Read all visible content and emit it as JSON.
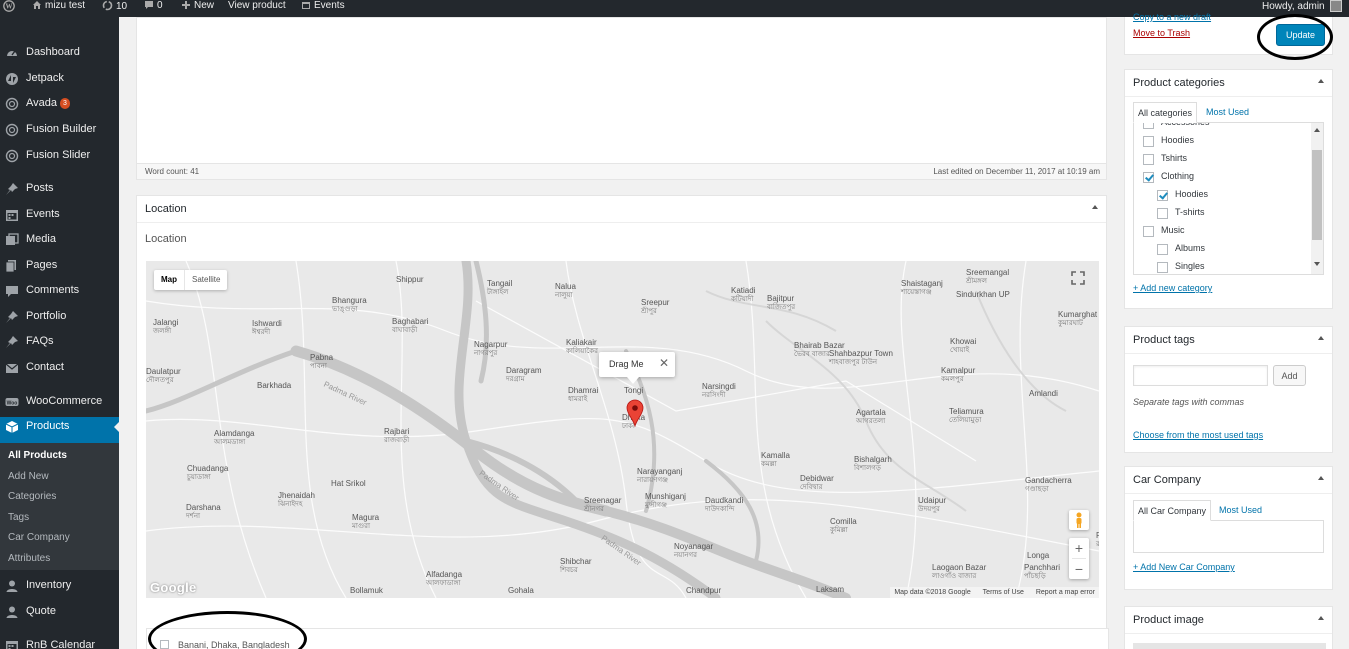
{
  "admin_bar": {
    "site_name": "mizu test",
    "updates_count": "10",
    "comments_count": "0",
    "new_label": "New",
    "view_product": "View product",
    "events": "Events",
    "howdy": "Howdy, admin"
  },
  "menu": [
    {
      "label": "Dashboard",
      "icon": "dashboard-icon"
    },
    {
      "label": "Jetpack",
      "icon": "jetpack-icon"
    },
    {
      "label": "Avada",
      "icon": "avada-icon",
      "badge": "3"
    },
    {
      "label": "Fusion Builder",
      "icon": "fusion-builder-icon"
    },
    {
      "label": "Fusion Slider",
      "icon": "fusion-slider-icon"
    },
    {
      "label": "Posts",
      "icon": "pin-icon"
    },
    {
      "label": "Events",
      "icon": "calendar-icon"
    },
    {
      "label": "Media",
      "icon": "media-icon"
    },
    {
      "label": "Pages",
      "icon": "pages-icon"
    },
    {
      "label": "Comments",
      "icon": "comments-icon"
    },
    {
      "label": "Portfolio",
      "icon": "pin-icon"
    },
    {
      "label": "FAQs",
      "icon": "pin-icon"
    },
    {
      "label": "Contact",
      "icon": "mail-icon"
    },
    {
      "label": "WooCommerce",
      "icon": "woo-icon"
    },
    {
      "label": "Products",
      "icon": "products-icon"
    },
    {
      "label": "Inventory",
      "icon": "users-icon"
    },
    {
      "label": "Quote",
      "icon": "users-icon"
    },
    {
      "label": "RnB Calendar",
      "icon": "calendar-icon"
    }
  ],
  "submenu": [
    "All Products",
    "Add New",
    "Categories",
    "Tags",
    "Car Company",
    "Attributes"
  ],
  "editor": {
    "word_count": "Word count: 41",
    "last_edited": "Last edited on December 11, 2017 at 10:19 am"
  },
  "location": {
    "box_title": "Location",
    "field_label": "Location",
    "map_tab": "Map",
    "satellite_tab": "Satellite",
    "marker_label": "Drag Me",
    "address": "Banani, Dhaka, Bangladesh",
    "map_footer": [
      "Map data ©2018 Google",
      "Terms of Use",
      "Report a map error"
    ],
    "google_logo": "Google",
    "zoom_in": "+",
    "zoom_out": "−"
  },
  "towns": [
    {
      "en": "Shippur",
      "bn": ""
    },
    {
      "en": "Tangail",
      "bn": "টাঙ্গাইল"
    },
    {
      "en": "Nalua",
      "bn": "নালুয়া"
    },
    {
      "en": "Sreepur",
      "bn": "শ্রীপুর"
    },
    {
      "en": "Katiadi",
      "bn": "কটিয়াদী"
    },
    {
      "en": "Bajitpur",
      "bn": "বাজিতপুর"
    },
    {
      "en": "Shaistaganj",
      "bn": "শায়েস্তাগঞ্জ"
    },
    {
      "en": "Sreemangal",
      "bn": "শ্রীমঙ্গল"
    },
    {
      "en": "Sindurkhan UP",
      "bn": ""
    },
    {
      "en": "Bhangura",
      "bn": "ভাঙ্গুড়া"
    },
    {
      "en": "Baghabari",
      "bn": "বাঘাবাড়ী"
    },
    {
      "en": "Ishwardi",
      "bn": "ঈশ্বরদী"
    },
    {
      "en": "Jalangi",
      "bn": "জলঙ্গী"
    },
    {
      "en": "Nagarpur",
      "bn": "নাগরপুর"
    },
    {
      "en": "Kaliakair",
      "bn": "কালিয়াকৈর"
    },
    {
      "en": "Bhairab Bazar",
      "bn": "ভৈরব বাজার"
    },
    {
      "en": "Shahbazpur Town",
      "bn": "শাহবাজপুর টাউন"
    },
    {
      "en": "Khowai",
      "bn": "খোয়াই"
    },
    {
      "en": "Kumarghat",
      "bn": "কুমারঘাট"
    },
    {
      "en": "Pabna",
      "bn": "পাবনা"
    },
    {
      "en": "Daulatpur",
      "bn": "দৌলতপুর"
    },
    {
      "en": "Daragram",
      "bn": "দরগ্রাম"
    },
    {
      "en": "Tongi",
      "bn": ""
    },
    {
      "en": "Dhamrai",
      "bn": "ধামরাই"
    },
    {
      "en": "Narsingdi",
      "bn": "নরসিংদী"
    },
    {
      "en": "Kamalpur",
      "bn": "কমলপুর"
    },
    {
      "en": "Barkhada",
      "bn": ""
    },
    {
      "en": "Dhaka",
      "bn": "ঢাকা"
    },
    {
      "en": "Agartala",
      "bn": "আগরতলা"
    },
    {
      "en": "Teliamura",
      "bn": "তেলিয়ামুড়া"
    },
    {
      "en": "Amlandi",
      "bn": ""
    },
    {
      "en": "Alamdanga",
      "bn": "আলমডাঙ্গা"
    },
    {
      "en": "Rajbari",
      "bn": "রাজবাড়ী"
    },
    {
      "en": "Kamalla",
      "bn": "কমল্লা"
    },
    {
      "en": "Bishalgarh",
      "bn": "বিশালগড়"
    },
    {
      "en": "Chuadanga",
      "bn": "চুয়াডাঙ্গা"
    },
    {
      "en": "Narayanganj",
      "bn": "নারায়ণগঞ্জ"
    },
    {
      "en": "Hat Srikol",
      "bn": ""
    },
    {
      "en": "Jhenaidah",
      "bn": "ঝিনাইদহ"
    },
    {
      "en": "Munshiganj",
      "bn": "মুন্সীগঞ্জ"
    },
    {
      "en": "Debidwar",
      "bn": "দেবিদ্বার"
    },
    {
      "en": "Gandacherra",
      "bn": "গণ্ডাছড়া"
    },
    {
      "en": "Sreenagar",
      "bn": "শ্রীনগর"
    },
    {
      "en": "Daudkandi",
      "bn": "দাউদকান্দি"
    },
    {
      "en": "Udaipur",
      "bn": "উদয়পুর"
    },
    {
      "en": "Darshana",
      "bn": "দর্শনা"
    },
    {
      "en": "Magura",
      "bn": "মাগুরা"
    },
    {
      "en": "Comilla",
      "bn": "কুমিল্লা"
    },
    {
      "en": "Noyanagar",
      "bn": "নয়ানগর"
    },
    {
      "en": "Shibchar",
      "bn": "শিবচর"
    },
    {
      "en": "Longa",
      "bn": ""
    },
    {
      "en": "Laogaon Bazar",
      "bn": "লাওগাঁও বাজার"
    },
    {
      "en": "Panchhari",
      "bn": "পাঁচছড়ি"
    },
    {
      "en": "Rangkhari",
      "bn": "রংখাড়ী"
    },
    {
      "en": "Alfadanga",
      "bn": "আলফাডাঙ্গা"
    },
    {
      "en": "Bollamuk",
      "bn": ""
    },
    {
      "en": "Gohala",
      "bn": ""
    },
    {
      "en": "Chandpur",
      "bn": ""
    },
    {
      "en": "Laksam",
      "bn": ""
    }
  ],
  "rivers": [
    "Padma River",
    "Padma River",
    "Padma River"
  ],
  "publish": {
    "copy_draft": "Copy to a new draft",
    "move_trash": "Move to Trash",
    "update": "Update"
  },
  "categories": {
    "title": "Product categories",
    "tab_all": "All categories",
    "tab_used": "Most Used",
    "items": [
      {
        "label": "Accessories",
        "checked": false
      },
      {
        "label": "Hoodies",
        "checked": false
      },
      {
        "label": "Tshirts",
        "checked": false
      },
      {
        "label": "Clothing",
        "checked": true
      },
      {
        "label": "Hoodies",
        "checked": true
      },
      {
        "label": "T-shirts",
        "checked": false
      },
      {
        "label": "Music",
        "checked": false
      },
      {
        "label": "Albums",
        "checked": false
      },
      {
        "label": "Singles",
        "checked": false
      }
    ],
    "add_new": "+ Add new category"
  },
  "tags": {
    "title": "Product tags",
    "input_value": "",
    "add_button": "Add",
    "hint": "Separate tags with commas",
    "choose_link": "Choose from the most used tags"
  },
  "car_company": {
    "title": "Car Company",
    "tab_all": "All Car Company",
    "tab_used": "Most Used",
    "add_new": "+ Add New Car Company"
  },
  "product_image": {
    "title": "Product image"
  },
  "colors": {
    "admin_bar": "#23282d",
    "sidebar": "#23282d",
    "active": "#0073aa",
    "link": "#0073aa",
    "trash": "#a00",
    "badge": "#d54e21",
    "marker": "#ea4335",
    "update_button": "#0085ba"
  }
}
